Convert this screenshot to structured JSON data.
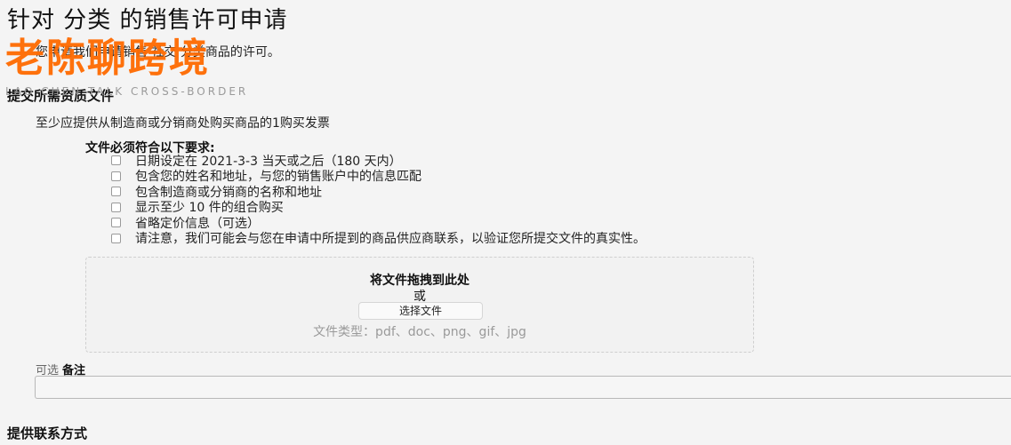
{
  "page": {
    "title": "针对 分类 的销售许可申请",
    "subtitle": "您申请我们申请销售 社交 分类商品的许可。"
  },
  "requirements_section": {
    "heading": "提交所需资质文件",
    "text": "至少应提供从制造商或分销商处购买商品的1购买发票",
    "list_heading": "文件必须符合以下要求:",
    "items": [
      "日期设定在 2021-3-3 当天或之后（180 天内）",
      "包含您的姓名和地址，与您的销售账户中的信息匹配",
      "包含制造商或分销商的名称和地址",
      "显示至少 10 件的组合购买",
      "省略定价信息（可选）",
      "请注意，我们可能会与您在申请中所提到的商品供应商联系，以验证您所提交文件的真实性。"
    ]
  },
  "upload": {
    "drop_label": "将文件拖拽到此处",
    "or_label": "或",
    "button_label": "选择文件",
    "file_types": "文件类型：pdf、doc、png、gif、jpg"
  },
  "notes": {
    "optional_label": "可选",
    "label": "备注",
    "value": ""
  },
  "contact_section": {
    "heading": "提供联系方式"
  },
  "watermark": {
    "brand": "老陈聊跨境",
    "sub": "LAO CHEN TALK CROSS-BORDER"
  }
}
